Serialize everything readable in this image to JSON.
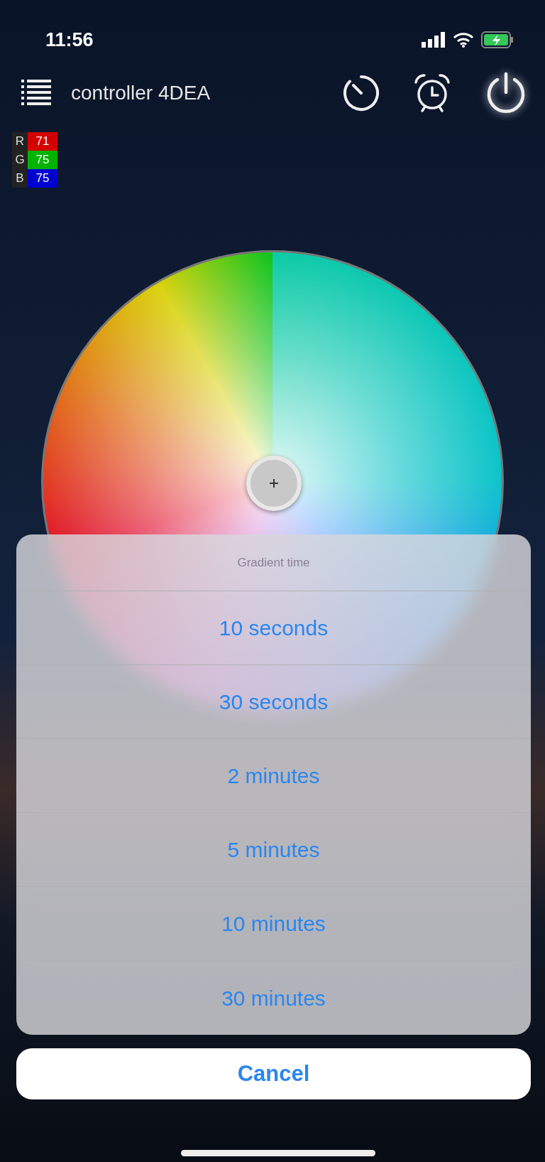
{
  "status_bar": {
    "time": "11:56"
  },
  "header": {
    "title": "controller 4DEA"
  },
  "rgb": [
    {
      "channel": "R",
      "value": "71",
      "color": "#d40000"
    },
    {
      "channel": "G",
      "value": "75",
      "color": "#00b400"
    },
    {
      "channel": "B",
      "value": "75",
      "color": "#0000d0"
    }
  ],
  "action_sheet": {
    "title": "Gradient time",
    "options": [
      "10 seconds",
      "30 seconds",
      "2 minutes",
      "5 minutes",
      "10 minutes",
      "30 minutes"
    ],
    "cancel": "Cancel"
  }
}
